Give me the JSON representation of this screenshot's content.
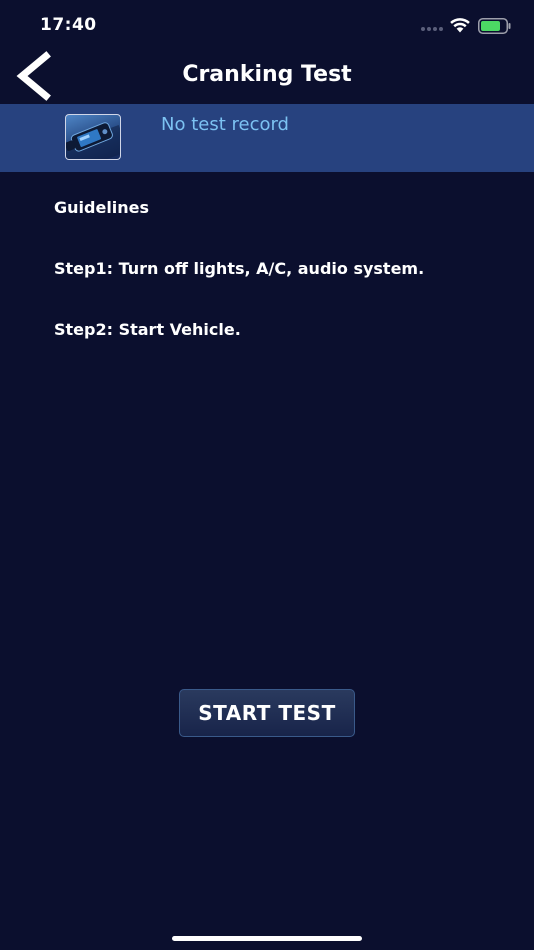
{
  "status_bar": {
    "time": "17:40",
    "icons": [
      "signal-dots-icon",
      "wifi-icon",
      "battery-icon"
    ],
    "battery_color": "#4cd964"
  },
  "nav": {
    "back_icon": "chevron-left-icon",
    "title": "Cranking Test"
  },
  "record": {
    "device_icon": "obd-device-icon",
    "status_text": "No test record",
    "bar_color": "#27427f",
    "text_color": "#7cc2f2"
  },
  "guidelines": {
    "heading": "Guidelines",
    "steps": [
      "Step1: Turn off lights, A/C, audio system.",
      "Step2: Start Vehicle."
    ]
  },
  "actions": {
    "start_label": "START TEST"
  },
  "theme": {
    "background": "#0b0f2e"
  }
}
